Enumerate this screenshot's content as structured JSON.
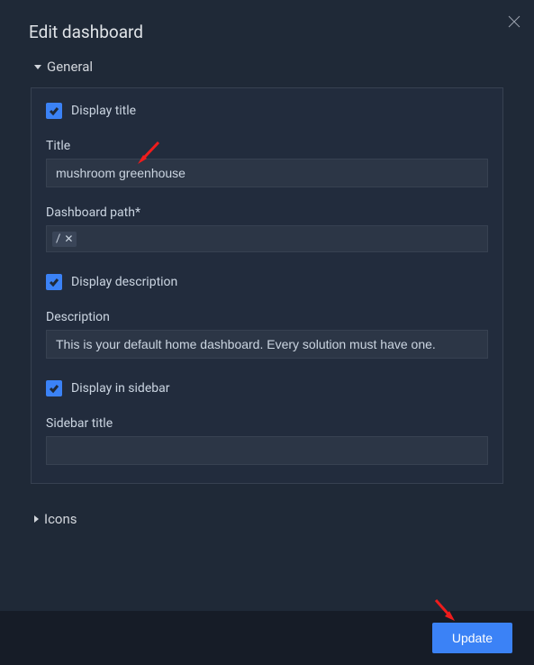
{
  "dialog": {
    "title": "Edit dashboard"
  },
  "sections": {
    "general": {
      "label": "General"
    },
    "icons": {
      "label": "Icons"
    }
  },
  "fields": {
    "display_title": {
      "label": "Display title"
    },
    "title": {
      "label": "Title",
      "value": "mushroom greenhouse"
    },
    "dashboard_path": {
      "label": "Dashboard path*",
      "chip": "/"
    },
    "display_description": {
      "label": "Display description"
    },
    "description": {
      "label": "Description",
      "value": "This is your default home dashboard. Every solution must have one."
    },
    "display_sidebar": {
      "label": "Display in sidebar"
    },
    "sidebar_title": {
      "label": "Sidebar title",
      "value": ""
    }
  },
  "footer": {
    "update": "Update"
  }
}
